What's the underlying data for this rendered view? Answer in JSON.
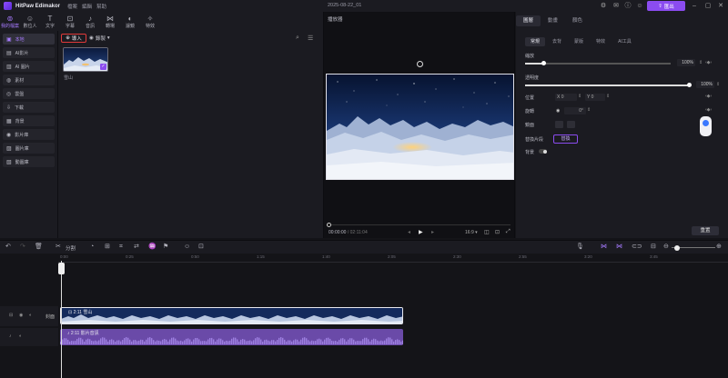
{
  "app": {
    "name": "HitPaw Edimakor",
    "menu": [
      "檔案",
      "編輯",
      "幫助"
    ],
    "project_title": "2025-08-22_01",
    "export_label": "匯出"
  },
  "tooltabs": [
    {
      "label": "我的檔案",
      "icon": "media-icon",
      "glyph": "⊚"
    },
    {
      "label": "數位人",
      "icon": "avatar-icon",
      "glyph": "☺"
    },
    {
      "label": "文字",
      "icon": "text-icon",
      "glyph": "T"
    },
    {
      "label": "字幕",
      "icon": "subtitle-icon",
      "glyph": "⊡"
    },
    {
      "label": "音訊",
      "icon": "audio-icon",
      "glyph": "♪"
    },
    {
      "label": "轉場",
      "icon": "transition-icon",
      "glyph": "⋈"
    },
    {
      "label": "濾鏡",
      "icon": "filter-icon",
      "glyph": "◐"
    },
    {
      "label": "特效",
      "icon": "effect-icon",
      "glyph": "✧"
    }
  ],
  "sidenav": [
    {
      "label": "本地",
      "glyph": "▣"
    },
    {
      "label": "AI影片",
      "glyph": "▤"
    },
    {
      "label": "AI 圖片",
      "glyph": "▥"
    },
    {
      "label": "素材",
      "glyph": "◍"
    },
    {
      "label": "雲盤",
      "glyph": "◎"
    },
    {
      "label": "下載",
      "glyph": "⇩"
    },
    {
      "label": "背景",
      "glyph": "▦"
    },
    {
      "label": "影片庫",
      "glyph": "◉"
    },
    {
      "label": "圖片庫",
      "glyph": "▨"
    },
    {
      "label": "動圖庫",
      "glyph": "▧"
    }
  ],
  "media": {
    "import_label": "導入",
    "record_label": "錄製",
    "thumb_label": "雪山"
  },
  "player": {
    "title": "播放器",
    "current_time": "00:00:00",
    "total_time": "/ 02:11:04",
    "ratio": "16:9"
  },
  "props": {
    "tabs": [
      "圖層",
      "動畫",
      "顏色"
    ],
    "subtabs": [
      "常規",
      "去背",
      "蒙版",
      "特效",
      "AI工具"
    ],
    "scale_label": "縮放",
    "scale_value": "100%",
    "scale_level": 0.13,
    "opacity_label": "透明度",
    "opacity_value": "100%",
    "opacity_level": 1.0,
    "position_label": "位置",
    "pos_x_label": "X",
    "pos_x": "0",
    "pos_y_label": "Y",
    "pos_y": "0",
    "rotation_label": "旋轉",
    "rotation_value": "0°",
    "mirror_label": "鏡面",
    "replace_label": "替換片段",
    "replace_btn": "替換",
    "background_label": "背景",
    "reset_label": "重置"
  },
  "timeline": {
    "split_label": "分割",
    "ruler": [
      "0:00",
      "0:25",
      "0:50",
      "1:15",
      "1:40",
      "2:05",
      "2:30",
      "2:55",
      "3:20",
      "3:45"
    ],
    "video_track_label": "封面",
    "video_clip_label": "2:11 雪山",
    "audio_clip_label": "2:11 影片音訊"
  }
}
